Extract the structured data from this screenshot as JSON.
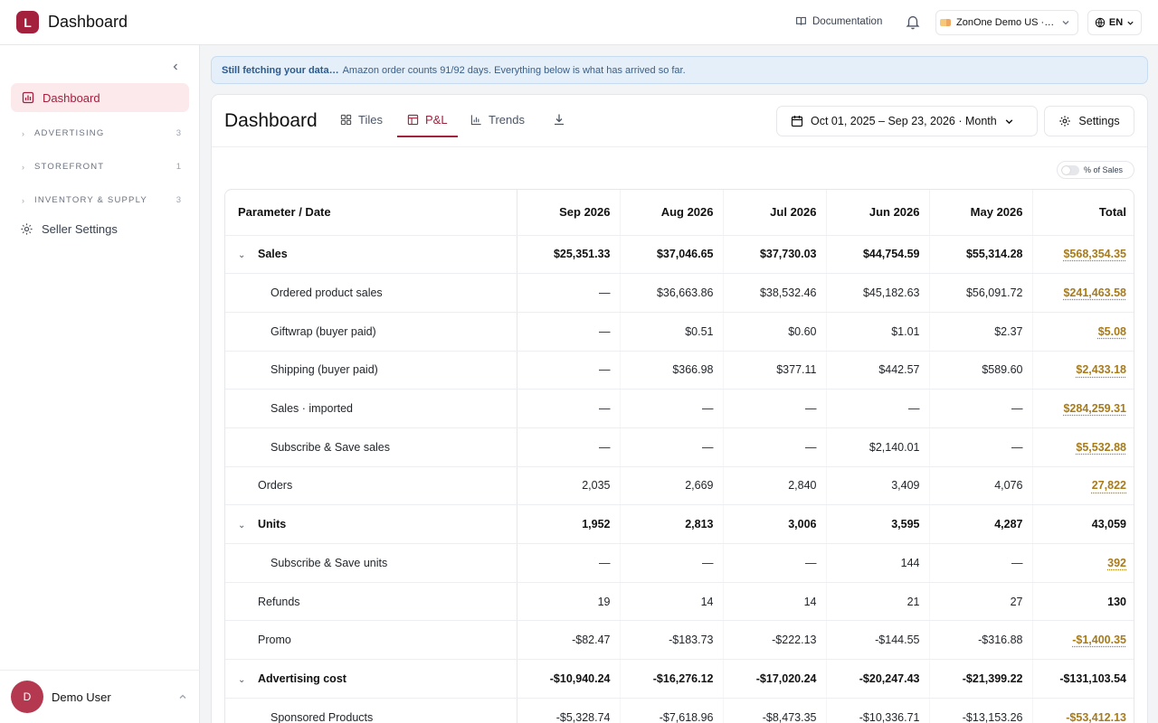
{
  "app": {
    "logo_letter": "L",
    "title": "Dashboard"
  },
  "topbar": {
    "documentation_label": "Documentation",
    "account_label": "ZonOne Demo US ·…",
    "language_label": "EN"
  },
  "sidebar": {
    "active_item": "Dashboard",
    "groups": [
      {
        "label": "ADVERTISING",
        "count": "3"
      },
      {
        "label": "STOREFRONT",
        "count": "1"
      },
      {
        "label": "INVENTORY & SUPPLY",
        "count": "3"
      }
    ],
    "seller_settings": "Seller Settings",
    "user": {
      "initial": "D",
      "name": "Demo User"
    }
  },
  "banner": {
    "bold": "Still fetching your data…",
    "text": "Amazon order counts 91/92 days. Everything below is what has arrived so far."
  },
  "card": {
    "title": "Dashboard",
    "tabs": {
      "tiles": "Tiles",
      "pl": "P&L",
      "trends": "Trends"
    },
    "active_tab": "P&L",
    "date_range": "Oct 01, 2025 – Sep 23, 2026 · Month",
    "settings_label": "Settings",
    "pct_toggle_label": "% of Sales"
  },
  "table": {
    "header": [
      "Parameter / Date",
      "Sep 2026",
      "Aug 2026",
      "Jul 2026",
      "Jun 2026",
      "May 2026",
      "Total"
    ],
    "rows": [
      {
        "label": "Sales",
        "cells": [
          "$25,351.33",
          "$37,046.65",
          "$37,730.03",
          "$44,754.59",
          "$55,314.28"
        ],
        "total": "$568,354.35"
      },
      {
        "label": "Ordered product sales",
        "cells": [
          "—",
          "$36,663.86",
          "$38,532.46",
          "$45,182.63",
          "$56,091.72"
        ],
        "total": "$241,463.58"
      },
      {
        "label": "Giftwrap (buyer paid)",
        "cells": [
          "—",
          "$0.51",
          "$0.60",
          "$1.01",
          "$2.37"
        ],
        "total": "$5.08"
      },
      {
        "label": "Shipping (buyer paid)",
        "cells": [
          "—",
          "$366.98",
          "$377.11",
          "$442.57",
          "$589.60"
        ],
        "total": "$2,433.18"
      },
      {
        "label": "Sales · imported",
        "cells": [
          "—",
          "—",
          "—",
          "—",
          "—"
        ],
        "total": "$284,259.31"
      },
      {
        "label": "Subscribe & Save sales",
        "cells": [
          "—",
          "—",
          "—",
          "$2,140.01",
          "—"
        ],
        "total": "$5,532.88"
      },
      {
        "label": "Orders",
        "cells": [
          "2,035",
          "2,669",
          "2,840",
          "3,409",
          "4,076"
        ],
        "total": "27,822"
      },
      {
        "label": "Units",
        "cells": [
          "1,952",
          "2,813",
          "3,006",
          "3,595",
          "4,287"
        ],
        "total": "43,059"
      },
      {
        "label": "Subscribe & Save units",
        "cells": [
          "—",
          "—",
          "—",
          "144",
          "—"
        ],
        "total": "392"
      },
      {
        "label": "Refunds",
        "cells": [
          "19",
          "14",
          "14",
          "21",
          "27"
        ],
        "total": "130"
      },
      {
        "label": "Promo",
        "cells": [
          "-$82.47",
          "-$183.73",
          "-$222.13",
          "-$144.55",
          "-$316.88"
        ],
        "total": "-$1,400.35"
      },
      {
        "label": "Advertising cost",
        "cells": [
          "-$10,940.24",
          "-$16,276.12",
          "-$17,020.24",
          "-$20,247.43",
          "-$21,399.22"
        ],
        "total": "-$131,103.54"
      },
      {
        "label": "Sponsored Products",
        "cells": [
          "-$5,328.74",
          "-$7,618.96",
          "-$8,473.35",
          "-$10,336.71",
          "-$13,153.26"
        ],
        "total": "-$53,412.13"
      }
    ]
  },
  "colors": {
    "brand": "#a3213d",
    "total_link": "#a87b1a",
    "banner_bg": "#e4effa"
  }
}
